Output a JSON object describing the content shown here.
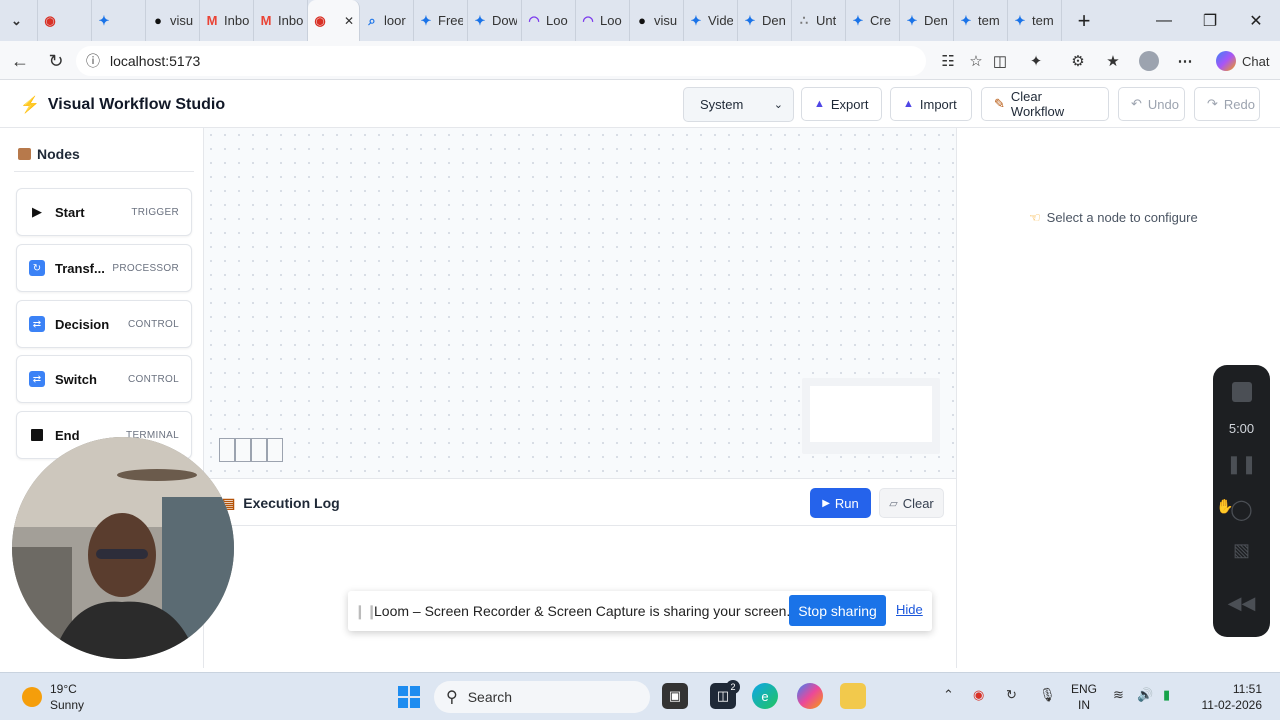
{
  "browser": {
    "tabs": [
      {
        "title": "",
        "icon": "tab-list-icon"
      },
      {
        "title": "",
        "icon": "recording-icon",
        "color": "#d93025"
      },
      {
        "title": "",
        "icon": "react-icon",
        "color": "#1a73e8"
      },
      {
        "title": "visu",
        "icon": "github-icon",
        "color": "#111"
      },
      {
        "title": "Inbo",
        "icon": "gmail-icon",
        "color": "#ea4335"
      },
      {
        "title": "Inbo",
        "icon": "gmail-icon",
        "color": "#ea4335"
      },
      {
        "title": "",
        "icon": "recording-icon",
        "color": "#d93025",
        "active": true
      },
      {
        "title": "loor",
        "icon": "search-icon",
        "color": "#1a73e8"
      },
      {
        "title": "Free",
        "icon": "react-icon",
        "color": "#1a73e8"
      },
      {
        "title": "Dow",
        "icon": "react-icon",
        "color": "#1a73e8"
      },
      {
        "title": "Loo",
        "icon": "rainbow-icon",
        "color": "#7c3aed"
      },
      {
        "title": "Loo",
        "icon": "rainbow-icon",
        "color": "#7c3aed"
      },
      {
        "title": "visu",
        "icon": "github-icon",
        "color": "#111"
      },
      {
        "title": "Vide",
        "icon": "react-icon",
        "color": "#1a73e8"
      },
      {
        "title": "Den",
        "icon": "react-icon",
        "color": "#1a73e8"
      },
      {
        "title": "Unt",
        "icon": "diagram-icon",
        "color": "#777"
      },
      {
        "title": "Cre",
        "icon": "react-icon",
        "color": "#1a73e8"
      },
      {
        "title": "Den",
        "icon": "react-icon",
        "color": "#1a73e8"
      },
      {
        "title": "tem",
        "icon": "react-icon",
        "color": "#1a73e8"
      },
      {
        "title": "tem",
        "icon": "react-icon",
        "color": "#1a73e8"
      }
    ],
    "url": "localhost:5173",
    "chat_label": "Chat"
  },
  "app": {
    "title": "Visual Workflow Studio",
    "theme_selected": "System",
    "export_label": "Export",
    "import_label": "Import",
    "clear_workflow_label": "Clear Workflow",
    "undo_label": "Undo",
    "redo_label": "Redo",
    "accent": "#2563eb"
  },
  "sidebar": {
    "title": "Nodes",
    "nodes": [
      {
        "label": "Start",
        "tag": "TRIGGER",
        "icon": "play-icon"
      },
      {
        "label": "Transf...",
        "tag": "PROCESSOR",
        "icon": "refresh-icon"
      },
      {
        "label": "Decision",
        "tag": "CONTROL",
        "icon": "shuffle-icon"
      },
      {
        "label": "Switch",
        "tag": "CONTROL",
        "icon": "shuffle-icon"
      },
      {
        "label": "End",
        "tag": "TERMINAL",
        "icon": "stop-icon"
      }
    ]
  },
  "log": {
    "title": "Execution Log",
    "run_label": "Run",
    "clear_label": "Clear"
  },
  "config": {
    "empty_message": "Select a node to configure"
  },
  "loom": {
    "message": "Loom – Screen Recorder & Screen Capture is sharing your screen.",
    "stop_label": "Stop sharing",
    "hide_label": "Hide",
    "timer": "5:00"
  },
  "taskbar": {
    "temperature": "19°C",
    "weather": "Sunny",
    "search_placeholder": "Search",
    "notification_count": "2",
    "lang_primary": "ENG",
    "lang_secondary": "IN",
    "time": "11:51",
    "date": "11-02-2026"
  }
}
